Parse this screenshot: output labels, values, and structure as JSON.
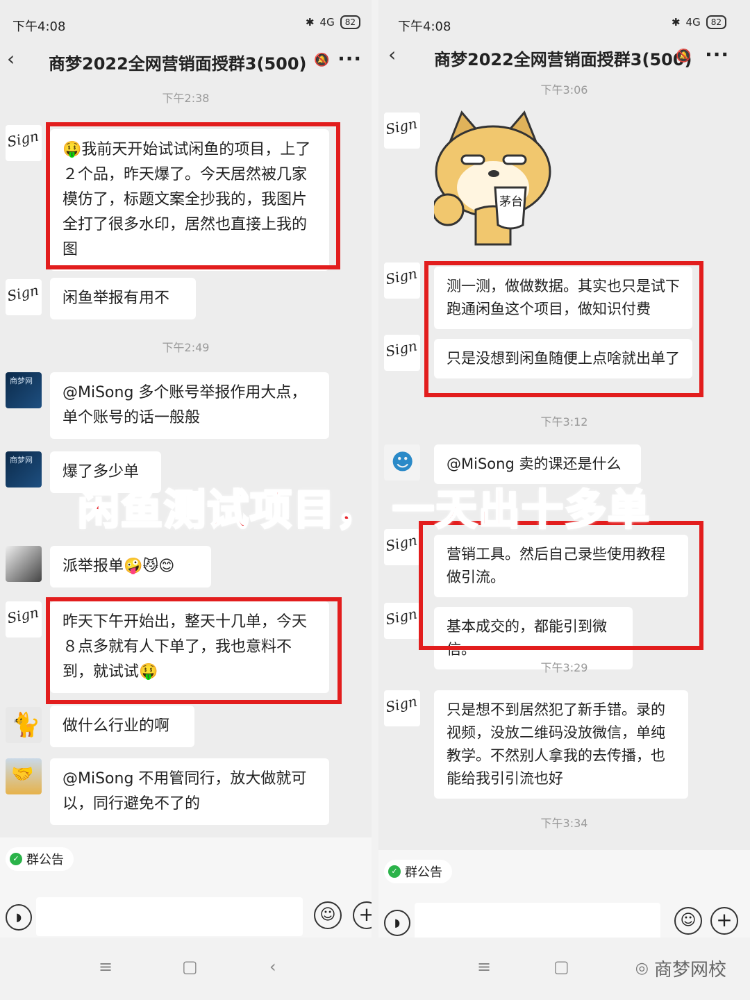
{
  "left": {
    "status_time": "下午4:08",
    "battery": "82",
    "signal": "4G",
    "title": "商梦2022全网营销面授群3(500)",
    "timestamps": [
      "下午2:38",
      "下午2:49"
    ],
    "messages": [
      "🤑我前天开始试试闲鱼的项目，上了２个品，昨天爆了。今天居然被几家模仿了，标题文案全抄我的，我图片全打了很多水印，居然也直接上我的图",
      "闲鱼举报有用不",
      "@MiSong 多个账号举报作用大点，单个账号的话一般般",
      "爆了多少单",
      "派举报单🤪😼😊",
      "昨天下午开始出，整天十几单，今天８点多就有人下单了，我也意料不到，就试试🤑",
      "做什么行业的啊",
      "@MiSong 不用管同行，放大做就可以，同行避免不了的"
    ],
    "notice": "群公告"
  },
  "right": {
    "status_time": "下午4:08",
    "battery": "82",
    "signal": "4G",
    "title": "商梦2022全网营销面授群3(500)",
    "timestamps": [
      "下午3:06",
      "下午3:12",
      "下午3:29",
      "下午3:34"
    ],
    "sticker_text": "茅台",
    "messages": [
      "测一测，做做数据。其实也只是试下跑通闲鱼这个项目，做知识付费",
      "只是没想到闲鱼随便上点啥就出单了",
      "@MiSong 卖的课还是什么",
      "营销工具。然后自己录些使用教程做引流。",
      "基本成交的，都能引到微信。",
      "只是想不到居然犯了新手错。录的视频，没放二维码没放微信，单纯教学。不然别人拿我的去传播，也能给我引引流也好"
    ],
    "notice": "群公告"
  },
  "overlay_left": "闲鱼测试项目，",
  "overlay_right": "一天出十多单",
  "watermark": "商梦网校",
  "colors": {
    "highlight_red": "#e21d1d",
    "overlay_red": "#e8242b",
    "bubble": "#ffffff",
    "chat_bg": "#ededed"
  }
}
